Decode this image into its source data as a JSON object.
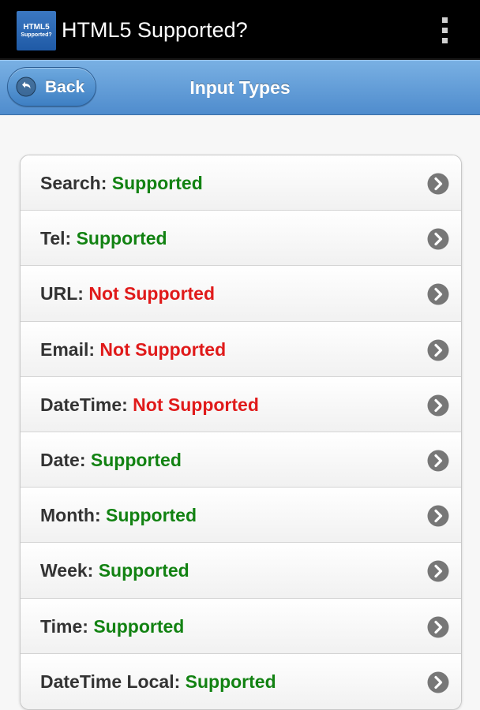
{
  "app_bar": {
    "icon_line1": "HTML5",
    "icon_line2": "Supported?",
    "title": "HTML5 Supported?",
    "menu_icon": "overflow-menu-icon"
  },
  "header": {
    "back_label": "Back",
    "back_icon": "back-arrow-icon",
    "title": "Input Types",
    "accent": "#4f8ccd"
  },
  "colors": {
    "supported": "#128212",
    "not_supported": "#e01a1a",
    "label": "#333333"
  },
  "items": [
    {
      "name": "Search:",
      "status": "Supported",
      "ok": true
    },
    {
      "name": "Tel:",
      "status": "Supported",
      "ok": true
    },
    {
      "name": "URL:",
      "status": "Not Supported",
      "ok": false
    },
    {
      "name": "Email:",
      "status": "Not Supported",
      "ok": false
    },
    {
      "name": "DateTime:",
      "status": "Not Supported",
      "ok": false
    },
    {
      "name": "Date:",
      "status": "Supported",
      "ok": true
    },
    {
      "name": "Month:",
      "status": "Supported",
      "ok": true
    },
    {
      "name": "Week:",
      "status": "Supported",
      "ok": true
    },
    {
      "name": "Time:",
      "status": "Supported",
      "ok": true
    },
    {
      "name": "DateTime Local:",
      "status": "Supported",
      "ok": true
    }
  ]
}
